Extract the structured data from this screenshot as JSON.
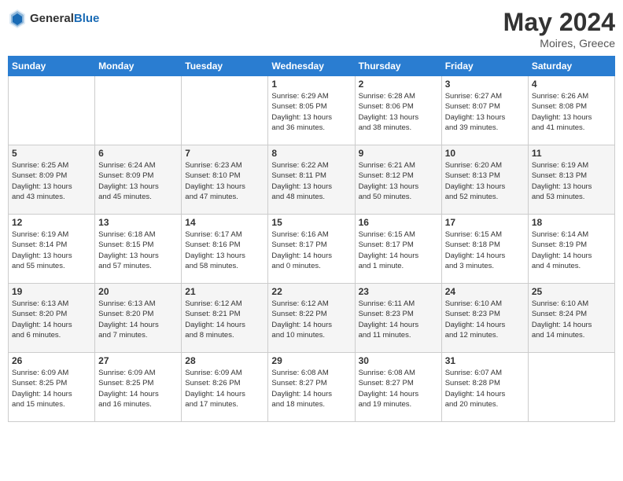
{
  "header": {
    "logo_general": "General",
    "logo_blue": "Blue",
    "month_year": "May 2024",
    "location": "Moires, Greece"
  },
  "days_of_week": [
    "Sunday",
    "Monday",
    "Tuesday",
    "Wednesday",
    "Thursday",
    "Friday",
    "Saturday"
  ],
  "weeks": [
    [
      {
        "day": "",
        "info": ""
      },
      {
        "day": "",
        "info": ""
      },
      {
        "day": "",
        "info": ""
      },
      {
        "day": "1",
        "info": "Sunrise: 6:29 AM\nSunset: 8:05 PM\nDaylight: 13 hours\nand 36 minutes."
      },
      {
        "day": "2",
        "info": "Sunrise: 6:28 AM\nSunset: 8:06 PM\nDaylight: 13 hours\nand 38 minutes."
      },
      {
        "day": "3",
        "info": "Sunrise: 6:27 AM\nSunset: 8:07 PM\nDaylight: 13 hours\nand 39 minutes."
      },
      {
        "day": "4",
        "info": "Sunrise: 6:26 AM\nSunset: 8:08 PM\nDaylight: 13 hours\nand 41 minutes."
      }
    ],
    [
      {
        "day": "5",
        "info": "Sunrise: 6:25 AM\nSunset: 8:09 PM\nDaylight: 13 hours\nand 43 minutes."
      },
      {
        "day": "6",
        "info": "Sunrise: 6:24 AM\nSunset: 8:09 PM\nDaylight: 13 hours\nand 45 minutes."
      },
      {
        "day": "7",
        "info": "Sunrise: 6:23 AM\nSunset: 8:10 PM\nDaylight: 13 hours\nand 47 minutes."
      },
      {
        "day": "8",
        "info": "Sunrise: 6:22 AM\nSunset: 8:11 PM\nDaylight: 13 hours\nand 48 minutes."
      },
      {
        "day": "9",
        "info": "Sunrise: 6:21 AM\nSunset: 8:12 PM\nDaylight: 13 hours\nand 50 minutes."
      },
      {
        "day": "10",
        "info": "Sunrise: 6:20 AM\nSunset: 8:13 PM\nDaylight: 13 hours\nand 52 minutes."
      },
      {
        "day": "11",
        "info": "Sunrise: 6:19 AM\nSunset: 8:13 PM\nDaylight: 13 hours\nand 53 minutes."
      }
    ],
    [
      {
        "day": "12",
        "info": "Sunrise: 6:19 AM\nSunset: 8:14 PM\nDaylight: 13 hours\nand 55 minutes."
      },
      {
        "day": "13",
        "info": "Sunrise: 6:18 AM\nSunset: 8:15 PM\nDaylight: 13 hours\nand 57 minutes."
      },
      {
        "day": "14",
        "info": "Sunrise: 6:17 AM\nSunset: 8:16 PM\nDaylight: 13 hours\nand 58 minutes."
      },
      {
        "day": "15",
        "info": "Sunrise: 6:16 AM\nSunset: 8:17 PM\nDaylight: 14 hours\nand 0 minutes."
      },
      {
        "day": "16",
        "info": "Sunrise: 6:15 AM\nSunset: 8:17 PM\nDaylight: 14 hours\nand 1 minute."
      },
      {
        "day": "17",
        "info": "Sunrise: 6:15 AM\nSunset: 8:18 PM\nDaylight: 14 hours\nand 3 minutes."
      },
      {
        "day": "18",
        "info": "Sunrise: 6:14 AM\nSunset: 8:19 PM\nDaylight: 14 hours\nand 4 minutes."
      }
    ],
    [
      {
        "day": "19",
        "info": "Sunrise: 6:13 AM\nSunset: 8:20 PM\nDaylight: 14 hours\nand 6 minutes."
      },
      {
        "day": "20",
        "info": "Sunrise: 6:13 AM\nSunset: 8:20 PM\nDaylight: 14 hours\nand 7 minutes."
      },
      {
        "day": "21",
        "info": "Sunrise: 6:12 AM\nSunset: 8:21 PM\nDaylight: 14 hours\nand 8 minutes."
      },
      {
        "day": "22",
        "info": "Sunrise: 6:12 AM\nSunset: 8:22 PM\nDaylight: 14 hours\nand 10 minutes."
      },
      {
        "day": "23",
        "info": "Sunrise: 6:11 AM\nSunset: 8:23 PM\nDaylight: 14 hours\nand 11 minutes."
      },
      {
        "day": "24",
        "info": "Sunrise: 6:10 AM\nSunset: 8:23 PM\nDaylight: 14 hours\nand 12 minutes."
      },
      {
        "day": "25",
        "info": "Sunrise: 6:10 AM\nSunset: 8:24 PM\nDaylight: 14 hours\nand 14 minutes."
      }
    ],
    [
      {
        "day": "26",
        "info": "Sunrise: 6:09 AM\nSunset: 8:25 PM\nDaylight: 14 hours\nand 15 minutes."
      },
      {
        "day": "27",
        "info": "Sunrise: 6:09 AM\nSunset: 8:25 PM\nDaylight: 14 hours\nand 16 minutes."
      },
      {
        "day": "28",
        "info": "Sunrise: 6:09 AM\nSunset: 8:26 PM\nDaylight: 14 hours\nand 17 minutes."
      },
      {
        "day": "29",
        "info": "Sunrise: 6:08 AM\nSunset: 8:27 PM\nDaylight: 14 hours\nand 18 minutes."
      },
      {
        "day": "30",
        "info": "Sunrise: 6:08 AM\nSunset: 8:27 PM\nDaylight: 14 hours\nand 19 minutes."
      },
      {
        "day": "31",
        "info": "Sunrise: 6:07 AM\nSunset: 8:28 PM\nDaylight: 14 hours\nand 20 minutes."
      },
      {
        "day": "",
        "info": ""
      }
    ]
  ]
}
